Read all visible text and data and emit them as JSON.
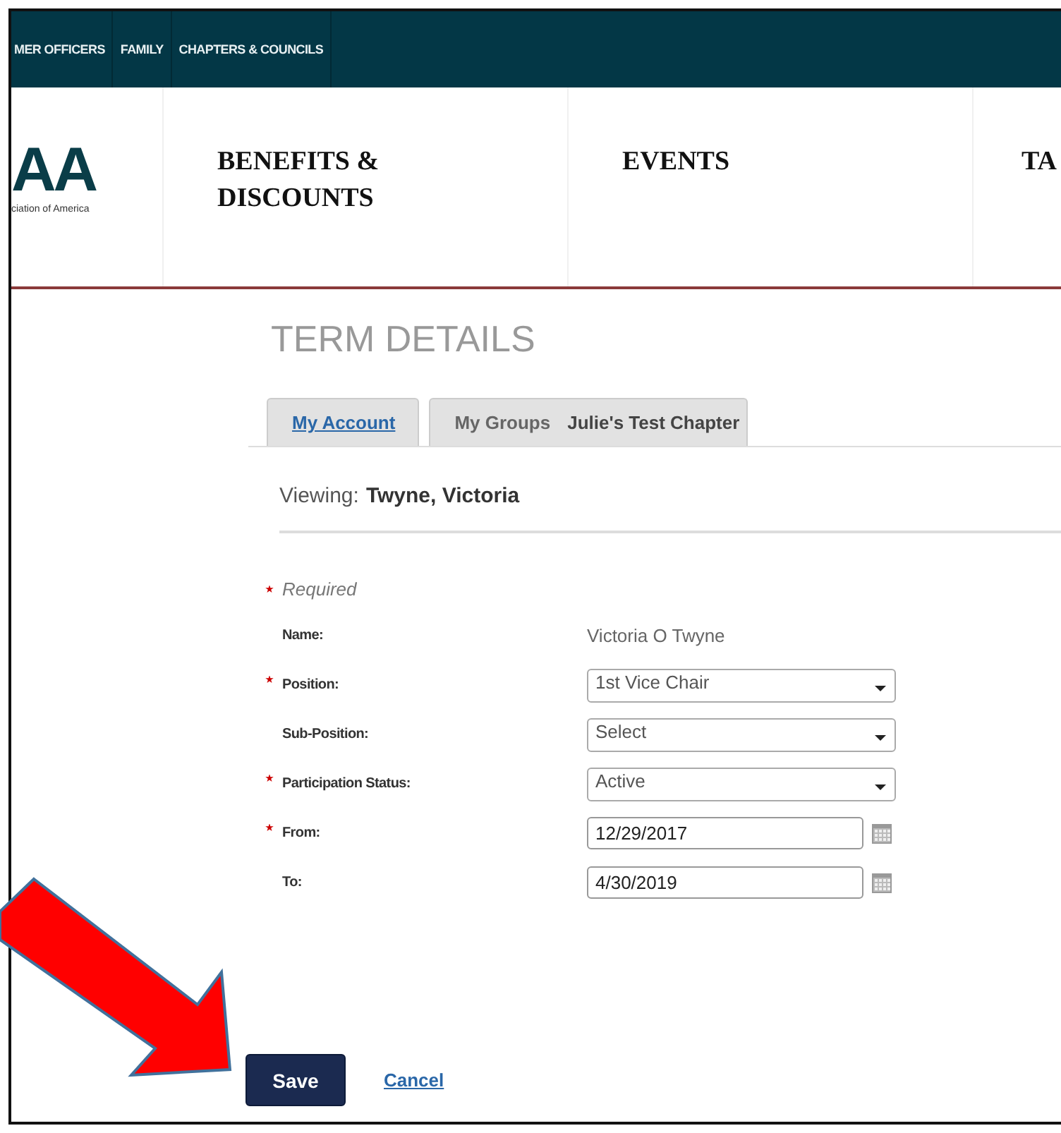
{
  "top_nav": {
    "items": [
      "MER OFFICERS",
      "FAMILY",
      "CHAPTERS & COUNCILS"
    ]
  },
  "header": {
    "logo": {
      "mark": "AA",
      "tagline": "ciation of America"
    },
    "nav": [
      "BENEFITS & DISCOUNTS",
      "EVENTS",
      "TA"
    ]
  },
  "page_title": "TERM DETAILS",
  "tabs": [
    {
      "label": "My Account",
      "selected": false
    },
    {
      "label": "My Groups",
      "detail": "Julie's Test Chapter",
      "selected": true
    }
  ],
  "viewing": {
    "label": "Viewing:",
    "value": "Twyne, Victoria"
  },
  "required_note": "Required",
  "fields": [
    {
      "kind": "text",
      "label": "Name:",
      "required": false,
      "value": "Victoria O Twyne"
    },
    {
      "kind": "select",
      "label": "Position:",
      "required": true,
      "value": "1st Vice Chair"
    },
    {
      "kind": "select",
      "label": "Sub-Position:",
      "required": false,
      "value": "Select"
    },
    {
      "kind": "select",
      "label": "Participation Status:",
      "required": true,
      "value": "Active"
    },
    {
      "kind": "date",
      "label": "From:",
      "required": true,
      "value": "12/29/2017"
    },
    {
      "kind": "date",
      "label": "To:",
      "required": false,
      "value": "4/30/2019"
    }
  ],
  "actions": {
    "save": "Save",
    "cancel": "Cancel"
  }
}
